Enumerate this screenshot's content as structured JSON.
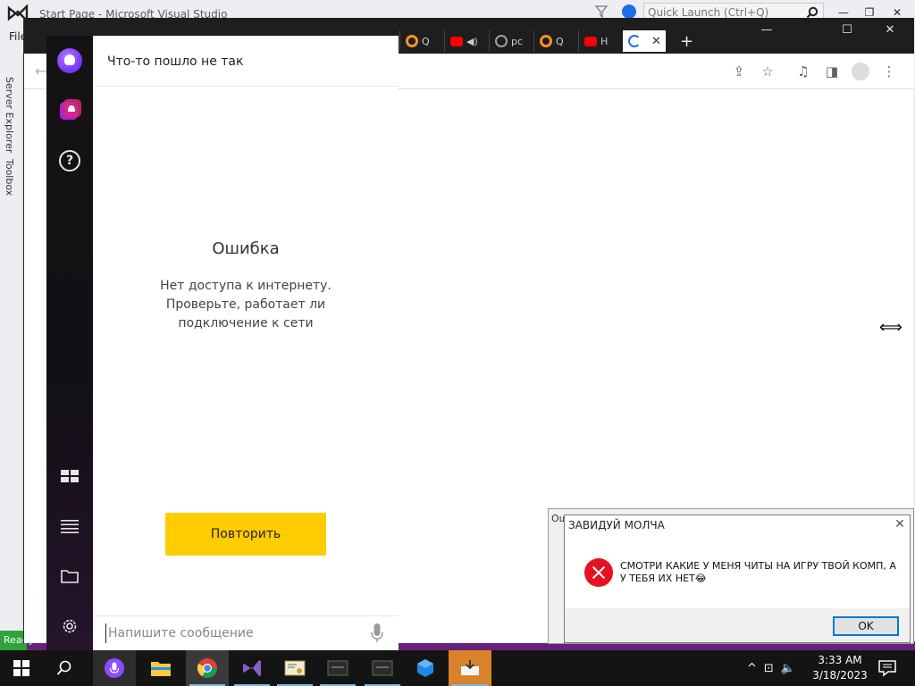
{
  "vs": {
    "title": "Start Page - Microsoft Visual Studio",
    "quick_launch_placeholder": "Quick Launch (Ctrl+Q)",
    "menu_file": "File",
    "side_tabs": [
      "Server Explorer",
      "Toolbox"
    ],
    "status": "Ready"
  },
  "chrome": {
    "tabs": [
      {
        "icon": "ok-ru-icon",
        "title": "Q",
        "color": "#f7931e"
      },
      {
        "icon": "youtube-icon",
        "title": "",
        "color": "#ff0000"
      },
      {
        "icon": "globe-icon",
        "title": "pc",
        "color": "#9aa0a6"
      },
      {
        "icon": "ok-ru-icon",
        "title": "Q",
        "color": "#f7931e"
      },
      {
        "icon": "youtube-icon",
        "title": "H",
        "color": "#ff0000"
      }
    ],
    "active_tab": {
      "icon": "loading-spinner-icon",
      "close": "✕"
    },
    "new_tab": "+"
  },
  "alice": {
    "header_title": "Что-то пошло не так",
    "error_title": "Ошибка",
    "error_message_lines": [
      "Нет доступа к интернету.",
      "Проверьте, работает ли",
      "подключение к сети"
    ],
    "retry_label": "Повторить",
    "input_placeholder": "Напишите сообщение"
  },
  "dialog": {
    "behind_title": "Ош",
    "title": "ЗАВИДУЙ МОЛЧА",
    "message": "СМОТРИ КАКИЕ У МЕНЯ ЧИТЫ НА ИГРУ ТВОЙ КОМП, А У ТЕБЯ ИХ НЕТ😂",
    "ok_label": "OK"
  },
  "taskbar": {
    "clock_time": "3:33 AM",
    "clock_date": "3/18/2023"
  },
  "colors": {
    "alice_accent": "#7a3cff",
    "retry_button": "#ffcc00",
    "vs_purple": "#68217a",
    "error_red": "#e81123"
  }
}
